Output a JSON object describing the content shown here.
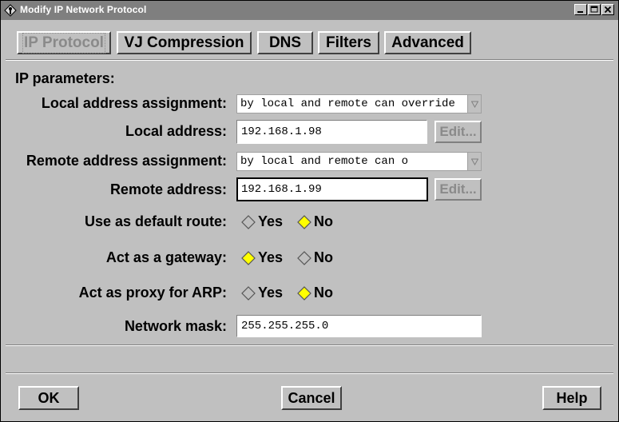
{
  "window": {
    "title": "Modify IP Network Protocol"
  },
  "tabs": [
    {
      "label": "IP Protocol",
      "selected": true
    },
    {
      "label": "VJ Compression",
      "selected": false
    },
    {
      "label": "DNS",
      "selected": false
    },
    {
      "label": "Filters",
      "selected": false
    },
    {
      "label": "Advanced",
      "selected": false
    }
  ],
  "section_title": "IP parameters:",
  "local_assignment": {
    "label": "Local address assignment:",
    "value": "by local and remote can override"
  },
  "local_address": {
    "label": "Local address:",
    "value": "192.168.1.98",
    "edit_label": "Edit..."
  },
  "remote_assignment": {
    "label": "Remote address assignment:",
    "value": "by local and remote can o"
  },
  "remote_address": {
    "label": "Remote address:",
    "value": "192.168.1.99",
    "edit_label": "Edit..."
  },
  "default_route": {
    "label": "Use as default route:",
    "yes": "Yes",
    "no": "No",
    "selected": "No"
  },
  "gateway": {
    "label": "Act as a gateway:",
    "yes": "Yes",
    "no": "No",
    "selected": "Yes"
  },
  "proxy_arp": {
    "label": "Act as proxy for ARP:",
    "yes": "Yes",
    "no": "No",
    "selected": "No"
  },
  "netmask": {
    "label": "Network mask:",
    "value": "255.255.255.0"
  },
  "buttons": {
    "ok": "OK",
    "cancel": "Cancel",
    "help": "Help"
  },
  "colors": {
    "titlebar": "#7f7f7f",
    "dialog": "#c0c0c0",
    "radio_selected": "#ffff00",
    "disabled_text": "#8a8a8a"
  }
}
